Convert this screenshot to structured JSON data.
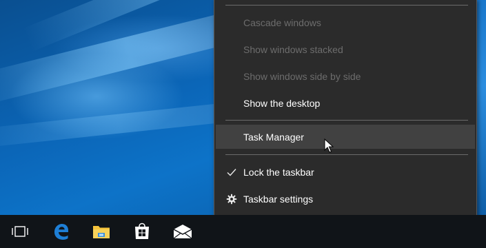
{
  "menu": {
    "items": [
      {
        "label": "Cascade windows",
        "enabled": false
      },
      {
        "label": "Show windows stacked",
        "enabled": false
      },
      {
        "label": "Show windows side by side",
        "enabled": false
      },
      {
        "label": "Show the desktop",
        "enabled": true
      },
      {
        "label": "Task Manager",
        "enabled": true,
        "highlighted": true
      },
      {
        "label": "Lock the taskbar",
        "enabled": true,
        "checked": true,
        "icon": "checkmark-icon"
      },
      {
        "label": "Taskbar settings",
        "enabled": true,
        "icon": "gear-icon"
      }
    ]
  },
  "taskbar": {
    "buttons": [
      {
        "icon": "task-view-icon"
      },
      {
        "icon": "edge-icon",
        "color": "#1e7fd6"
      },
      {
        "icon": "file-explorer-icon",
        "color": "#f5c33b"
      },
      {
        "icon": "store-icon"
      },
      {
        "icon": "mail-icon"
      }
    ]
  },
  "colors": {
    "menu_background": "#2b2b2b",
    "menu_hover": "#414141",
    "menu_disabled_text": "#6d6d6d",
    "taskbar_background": "#101418"
  }
}
